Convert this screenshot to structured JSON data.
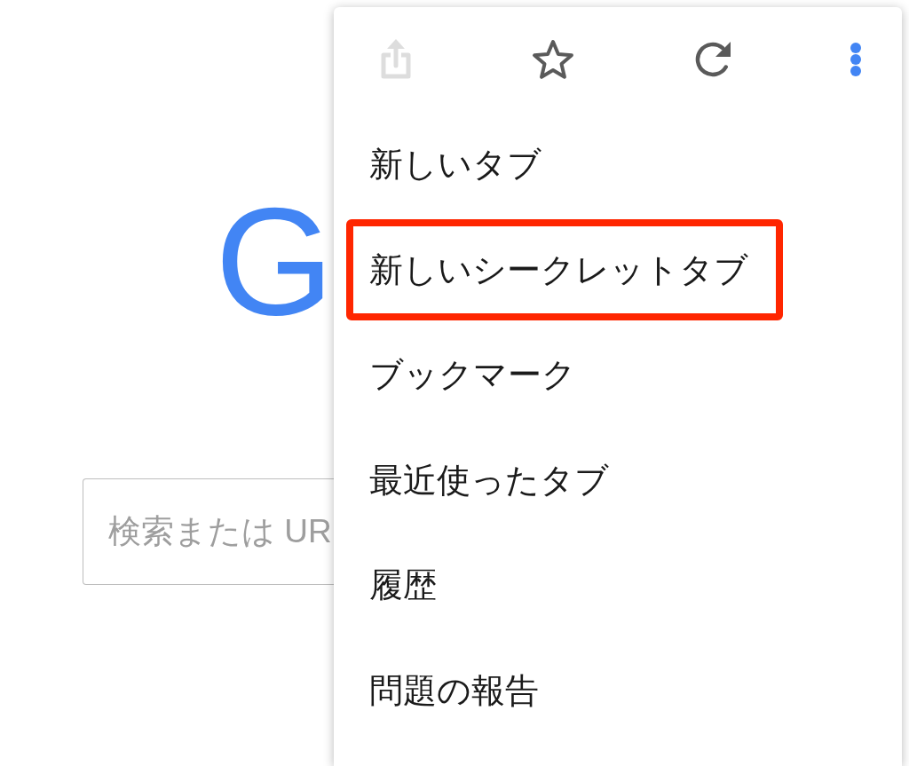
{
  "page": {
    "logo": {
      "text": "G"
    },
    "search": {
      "placeholder": "検索または UR"
    }
  },
  "menu": {
    "toolbar": [
      {
        "kind": "share",
        "disabled": true,
        "active": false
      },
      {
        "kind": "star",
        "disabled": false,
        "active": false
      },
      {
        "kind": "reload",
        "disabled": false,
        "active": false
      },
      {
        "kind": "more",
        "disabled": false,
        "active": true
      }
    ],
    "items": [
      {
        "label": "新しいタブ",
        "highlighted": false
      },
      {
        "label": "新しいシークレットタブ",
        "highlighted": true
      },
      {
        "label": "ブックマーク",
        "highlighted": false
      },
      {
        "label": "最近使ったタブ",
        "highlighted": false
      },
      {
        "label": "履歴",
        "highlighted": false
      },
      {
        "label": "問題の報告",
        "highlighted": false
      }
    ]
  }
}
